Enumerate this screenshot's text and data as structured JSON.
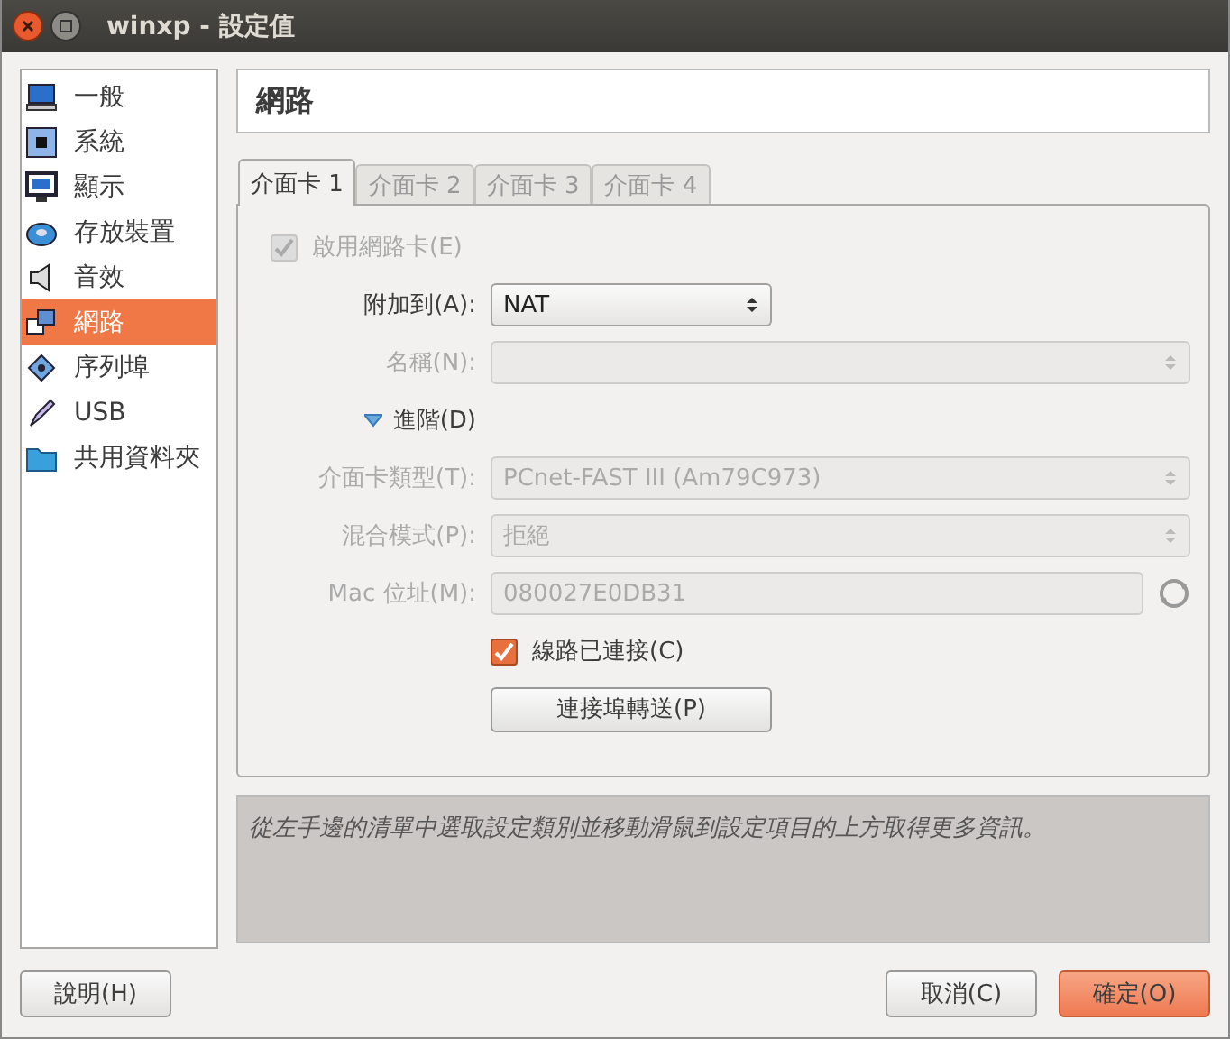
{
  "window": {
    "title": "winxp - 設定值"
  },
  "sidebar": {
    "items": [
      {
        "label": "一般",
        "selected": false
      },
      {
        "label": "系統",
        "selected": false
      },
      {
        "label": "顯示",
        "selected": false
      },
      {
        "label": "存放裝置",
        "selected": false
      },
      {
        "label": "音效",
        "selected": false
      },
      {
        "label": "網路",
        "selected": true
      },
      {
        "label": "序列埠",
        "selected": false
      },
      {
        "label": "USB",
        "selected": false
      },
      {
        "label": "共用資料夾",
        "selected": false
      }
    ]
  },
  "header": {
    "title": "網路"
  },
  "tabs": [
    {
      "label": "介面卡 1",
      "selected": true
    },
    {
      "label": "介面卡 2",
      "selected": false
    },
    {
      "label": "介面卡 3",
      "selected": false
    },
    {
      "label": "介面卡 4",
      "selected": false
    }
  ],
  "form": {
    "rows": [
      {
        "kind": "checkbox",
        "label": "啟用網路卡(E)",
        "checked": true,
        "disabled": true
      },
      {
        "kind": "select",
        "label": "附加到(A):",
        "value": "NAT",
        "disabled": false,
        "wide": false
      },
      {
        "kind": "select",
        "label": "名稱(N):",
        "disabled": true,
        "wide": true
      },
      {
        "kind": "expander",
        "label": "進階(D)",
        "expanded": true
      },
      {
        "kind": "select",
        "label": "介面卡類型(T):",
        "value": "PCnet-FAST III (Am79C973)",
        "disabled": true,
        "wide": true
      },
      {
        "kind": "select",
        "label": "混合模式(P):",
        "value": "拒絕",
        "disabled": true,
        "wide": true
      },
      {
        "kind": "text",
        "label": "Mac 位址(M):",
        "value": "080027E0DB31",
        "disabled": true
      },
      {
        "kind": "checkbox",
        "label": "線路已連接(C)",
        "checked": true,
        "disabled": false
      },
      {
        "kind": "button",
        "label": "連接埠轉送(P)"
      }
    ]
  },
  "info": {
    "text": "從左手邊的清單中選取設定類別並移動滑鼠到設定項目的上方取得更多資訊。"
  },
  "buttons": [
    {
      "label": "說明(H)",
      "default": false
    },
    {
      "label": "取消(C)",
      "default": false
    },
    {
      "label": "確定(O)",
      "default": true
    }
  ]
}
